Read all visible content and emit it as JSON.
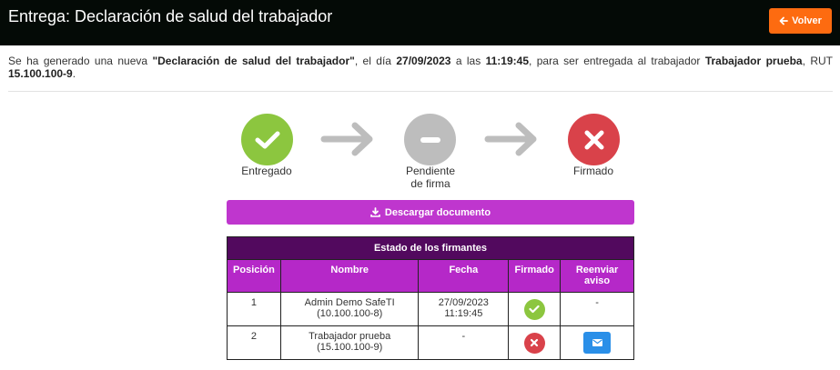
{
  "header": {
    "title": "Entrega: Declaración de salud del trabajador",
    "back_label": "Volver",
    "back_icon": "arrow-left-icon"
  },
  "intro": {
    "p1": "Se ha generado una nueva ",
    "doc_name": "\"Declaración de salud del trabajador\"",
    "p2": ", el día ",
    "date": "27/09/2023",
    "p3": " a las ",
    "time": "11:19:45",
    "p4": ", para ser entregada al trabajador ",
    "worker": "Trabajador prueba",
    "p5": ", RUT ",
    "rut": "15.100.100-9",
    "p6": "."
  },
  "steps": [
    {
      "label": "Entregado",
      "status": "done",
      "color": "#8cc63f",
      "icon": "check-icon"
    },
    {
      "label": "Pendiente de firma",
      "status": "pending",
      "color": "#bdbdbd",
      "icon": "minus-icon"
    },
    {
      "label": "Firmado",
      "status": "not-done",
      "color": "#d9424a",
      "icon": "x-icon"
    }
  ],
  "download": {
    "label": "Descargar documento",
    "icon": "download-icon"
  },
  "signers_table": {
    "title": "Estado de los firmantes",
    "columns": [
      "Posición",
      "Nombre",
      "Fecha",
      "Firmado",
      "Reenviar aviso"
    ],
    "rows": [
      {
        "position": "1",
        "name": "Admin Demo SafeTI",
        "rut": "(10.100.100-8)",
        "date": "27/09/2023",
        "time": "11:19:45",
        "signed": true,
        "resend": "-"
      },
      {
        "position": "2",
        "name": "Trabajador prueba",
        "rut": "(15.100.100-9)",
        "date": "-",
        "time": "",
        "signed": false,
        "resend": "mail-icon"
      }
    ]
  },
  "colors": {
    "header_bg": "#040a06",
    "back_button": "#fd6b10",
    "download_button": "#bf36ce",
    "table_title_bg": "#52095e",
    "table_head_bg": "#b528c8",
    "mail_button": "#2a8fe8"
  }
}
